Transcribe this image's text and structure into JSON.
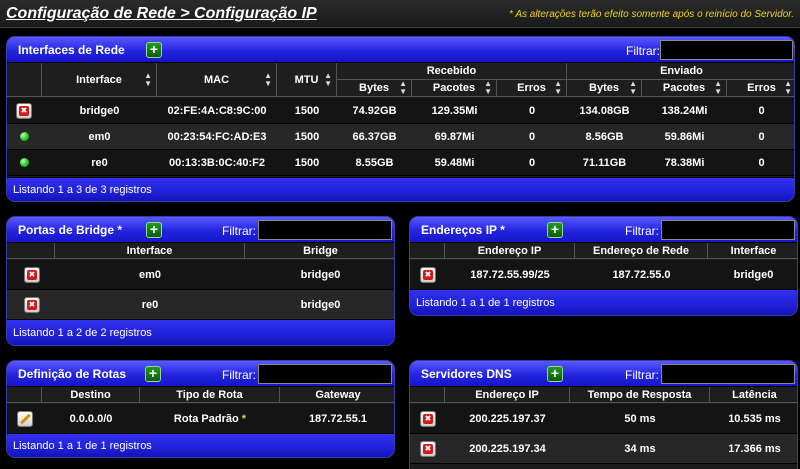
{
  "header": {
    "title": "Configuração de Rede > Configuração IP",
    "notice": "* As alterações terão efeito somente após o reinício do Servidor."
  },
  "interfaces": {
    "title": "Interfaces de Rede",
    "add_label": "+",
    "filter_label": "Filtrar:",
    "filter_value": "",
    "columns": {
      "interface": "Interface",
      "mac": "MAC",
      "mtu": "MTU",
      "received": "Recebido",
      "sent": "Enviado",
      "bytes": "Bytes",
      "packets": "Pacotes",
      "errors": "Erros"
    },
    "rows": [
      {
        "action": "delete",
        "name": "bridge0",
        "mac": "02:FE:4A:C8:9C:00",
        "mtu": "1500",
        "rx_bytes": "74.92GB",
        "rx_packets": "129.35Mi",
        "rx_errors": "0",
        "tx_bytes": "134.08GB",
        "tx_packets": "138.24Mi",
        "tx_errors": "0"
      },
      {
        "action": "status-up",
        "name": "em0",
        "mac": "00:23:54:FC:AD:E3",
        "mtu": "1500",
        "rx_bytes": "66.37GB",
        "rx_packets": "69.87Mi",
        "rx_errors": "0",
        "tx_bytes": "8.56GB",
        "tx_packets": "59.86Mi",
        "tx_errors": "0"
      },
      {
        "action": "status-up",
        "name": "re0",
        "mac": "00:13:3B:0C:40:F2",
        "mtu": "1500",
        "rx_bytes": "8.55GB",
        "rx_packets": "59.48Mi",
        "rx_errors": "0",
        "tx_bytes": "71.11GB",
        "tx_packets": "78.38Mi",
        "tx_errors": "0"
      }
    ],
    "footer": "Listando 1 a 3 de 3 registros"
  },
  "bridge_ports": {
    "title": "Portas de Bridge",
    "required_mark": "*",
    "add_label": "+",
    "filter_label": "Filtrar:",
    "filter_value": "",
    "columns": {
      "interface": "Interface",
      "bridge": "Bridge"
    },
    "rows": [
      {
        "interface": "em0",
        "bridge": "bridge0"
      },
      {
        "interface": "re0",
        "bridge": "bridge0"
      }
    ],
    "footer": "Listando 1 a 2 de 2 registros"
  },
  "ip_addresses": {
    "title": "Endereços IP",
    "required_mark": "*",
    "add_label": "+",
    "filter_label": "Filtrar:",
    "filter_value": "",
    "columns": {
      "address": "Endereço IP",
      "network": "Endereço de Rede",
      "interface": "Interface"
    },
    "rows": [
      {
        "address": "187.72.55.99/25",
        "network": "187.72.55.0",
        "interface": "bridge0"
      }
    ],
    "footer": "Listando 1 a 1 de 1 registros"
  },
  "routes": {
    "title": "Definição de Rotas",
    "add_label": "+",
    "filter_label": "Filtrar:",
    "filter_value": "",
    "columns": {
      "destination": "Destino",
      "type": "Tipo de Rota",
      "gateway": "Gateway"
    },
    "rows": [
      {
        "destination": "0.0.0.0/0",
        "type": "Rota Padrão",
        "type_mark": "*",
        "gateway": "187.72.55.1"
      }
    ],
    "footer": "Listando 1 a 1 de 1 registros"
  },
  "dns": {
    "title": "Servidores DNS",
    "add_label": "+",
    "filter_label": "Filtrar:",
    "filter_value": "",
    "columns": {
      "address": "Endereço IP",
      "response": "Tempo de Resposta",
      "latency": "Latência"
    },
    "rows": [
      {
        "address": "200.225.197.37",
        "response": "50 ms",
        "latency": "10.535 ms"
      },
      {
        "address": "200.225.197.34",
        "response": "34 ms",
        "latency": "17.366 ms"
      }
    ]
  },
  "colors": {
    "header_blue": "#2424e0",
    "notice_yellow": "#f2d21a",
    "add_green": "#1f9b1f",
    "delete_red": "#d31a1a",
    "status_green": "#22c722"
  }
}
